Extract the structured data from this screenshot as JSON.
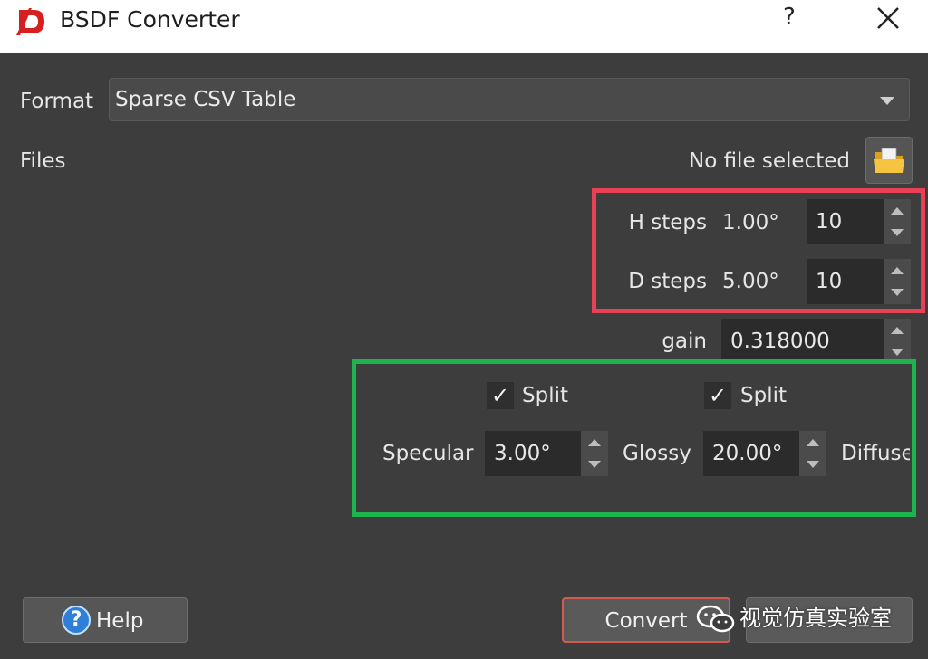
{
  "window": {
    "title": "BSDF Converter",
    "help_glyph": "?",
    "icons": {
      "app": "app-logo-icon",
      "close": "close-icon",
      "open": "folder-open-icon",
      "help": "help-icon"
    }
  },
  "format": {
    "label": "Format",
    "value": "Sparse CSV Table"
  },
  "files": {
    "label": "Files",
    "status": "No file selected"
  },
  "steps": {
    "h_label": "H steps",
    "h_angle": "1.00°",
    "h_value": "10",
    "d_label": "D steps",
    "d_angle": "5.00°",
    "d_value": "10"
  },
  "gain": {
    "label": "gain",
    "value": "0.318000"
  },
  "lobes": {
    "split1": "Split",
    "split2": "Split",
    "specular_label": "Specular",
    "specular_value": "3.00°",
    "glossy_label": "Glossy",
    "glossy_value": "20.00°",
    "diffuse_label": "Diffuse"
  },
  "buttons": {
    "help": "Help",
    "convert": "Convert",
    "help_glyph": "?"
  },
  "watermark": {
    "text": "视觉仿真实验室"
  },
  "colors": {
    "red_box": "#e84155",
    "green_box": "#1db34e",
    "dialog_bg": "#3d3d3d"
  }
}
